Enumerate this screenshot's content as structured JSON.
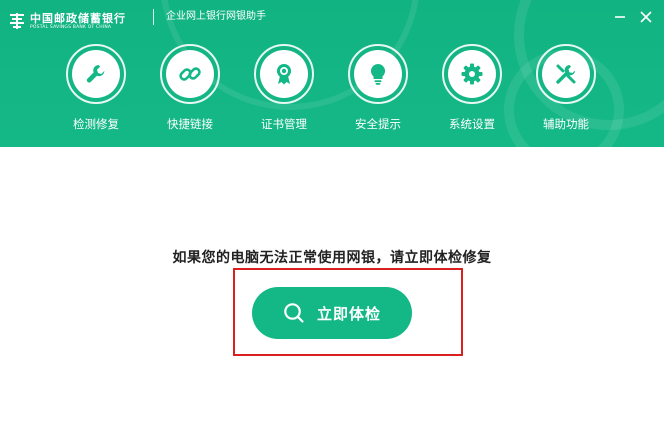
{
  "header": {
    "logo_cn": "中国邮政储蓄银行",
    "logo_en": "POSTAL SAVINGS BANK OF CHINA",
    "app_title": "企业网上银行网银助手"
  },
  "window_controls": [
    {
      "icon": "minimize-icon"
    },
    {
      "icon": "close-icon"
    }
  ],
  "nav": [
    {
      "label": "检测修复",
      "icon": "wrench-icon"
    },
    {
      "label": "快捷链接",
      "icon": "link-icon"
    },
    {
      "label": "证书管理",
      "icon": "certificate-icon"
    },
    {
      "label": "安全提示",
      "icon": "lightbulb-icon"
    },
    {
      "label": "系统设置",
      "icon": "gear-icon"
    },
    {
      "label": "辅助功能",
      "icon": "tools-icon"
    }
  ],
  "main": {
    "prompt": "如果您的电脑无法正常使用网银，请立即体检修复",
    "check_button_label": "立即体检",
    "check_button_icon": "search-icon"
  },
  "colors": {
    "brand_green": "#14b886",
    "highlight_red": "#d9201e",
    "text_dark": "#222222"
  }
}
